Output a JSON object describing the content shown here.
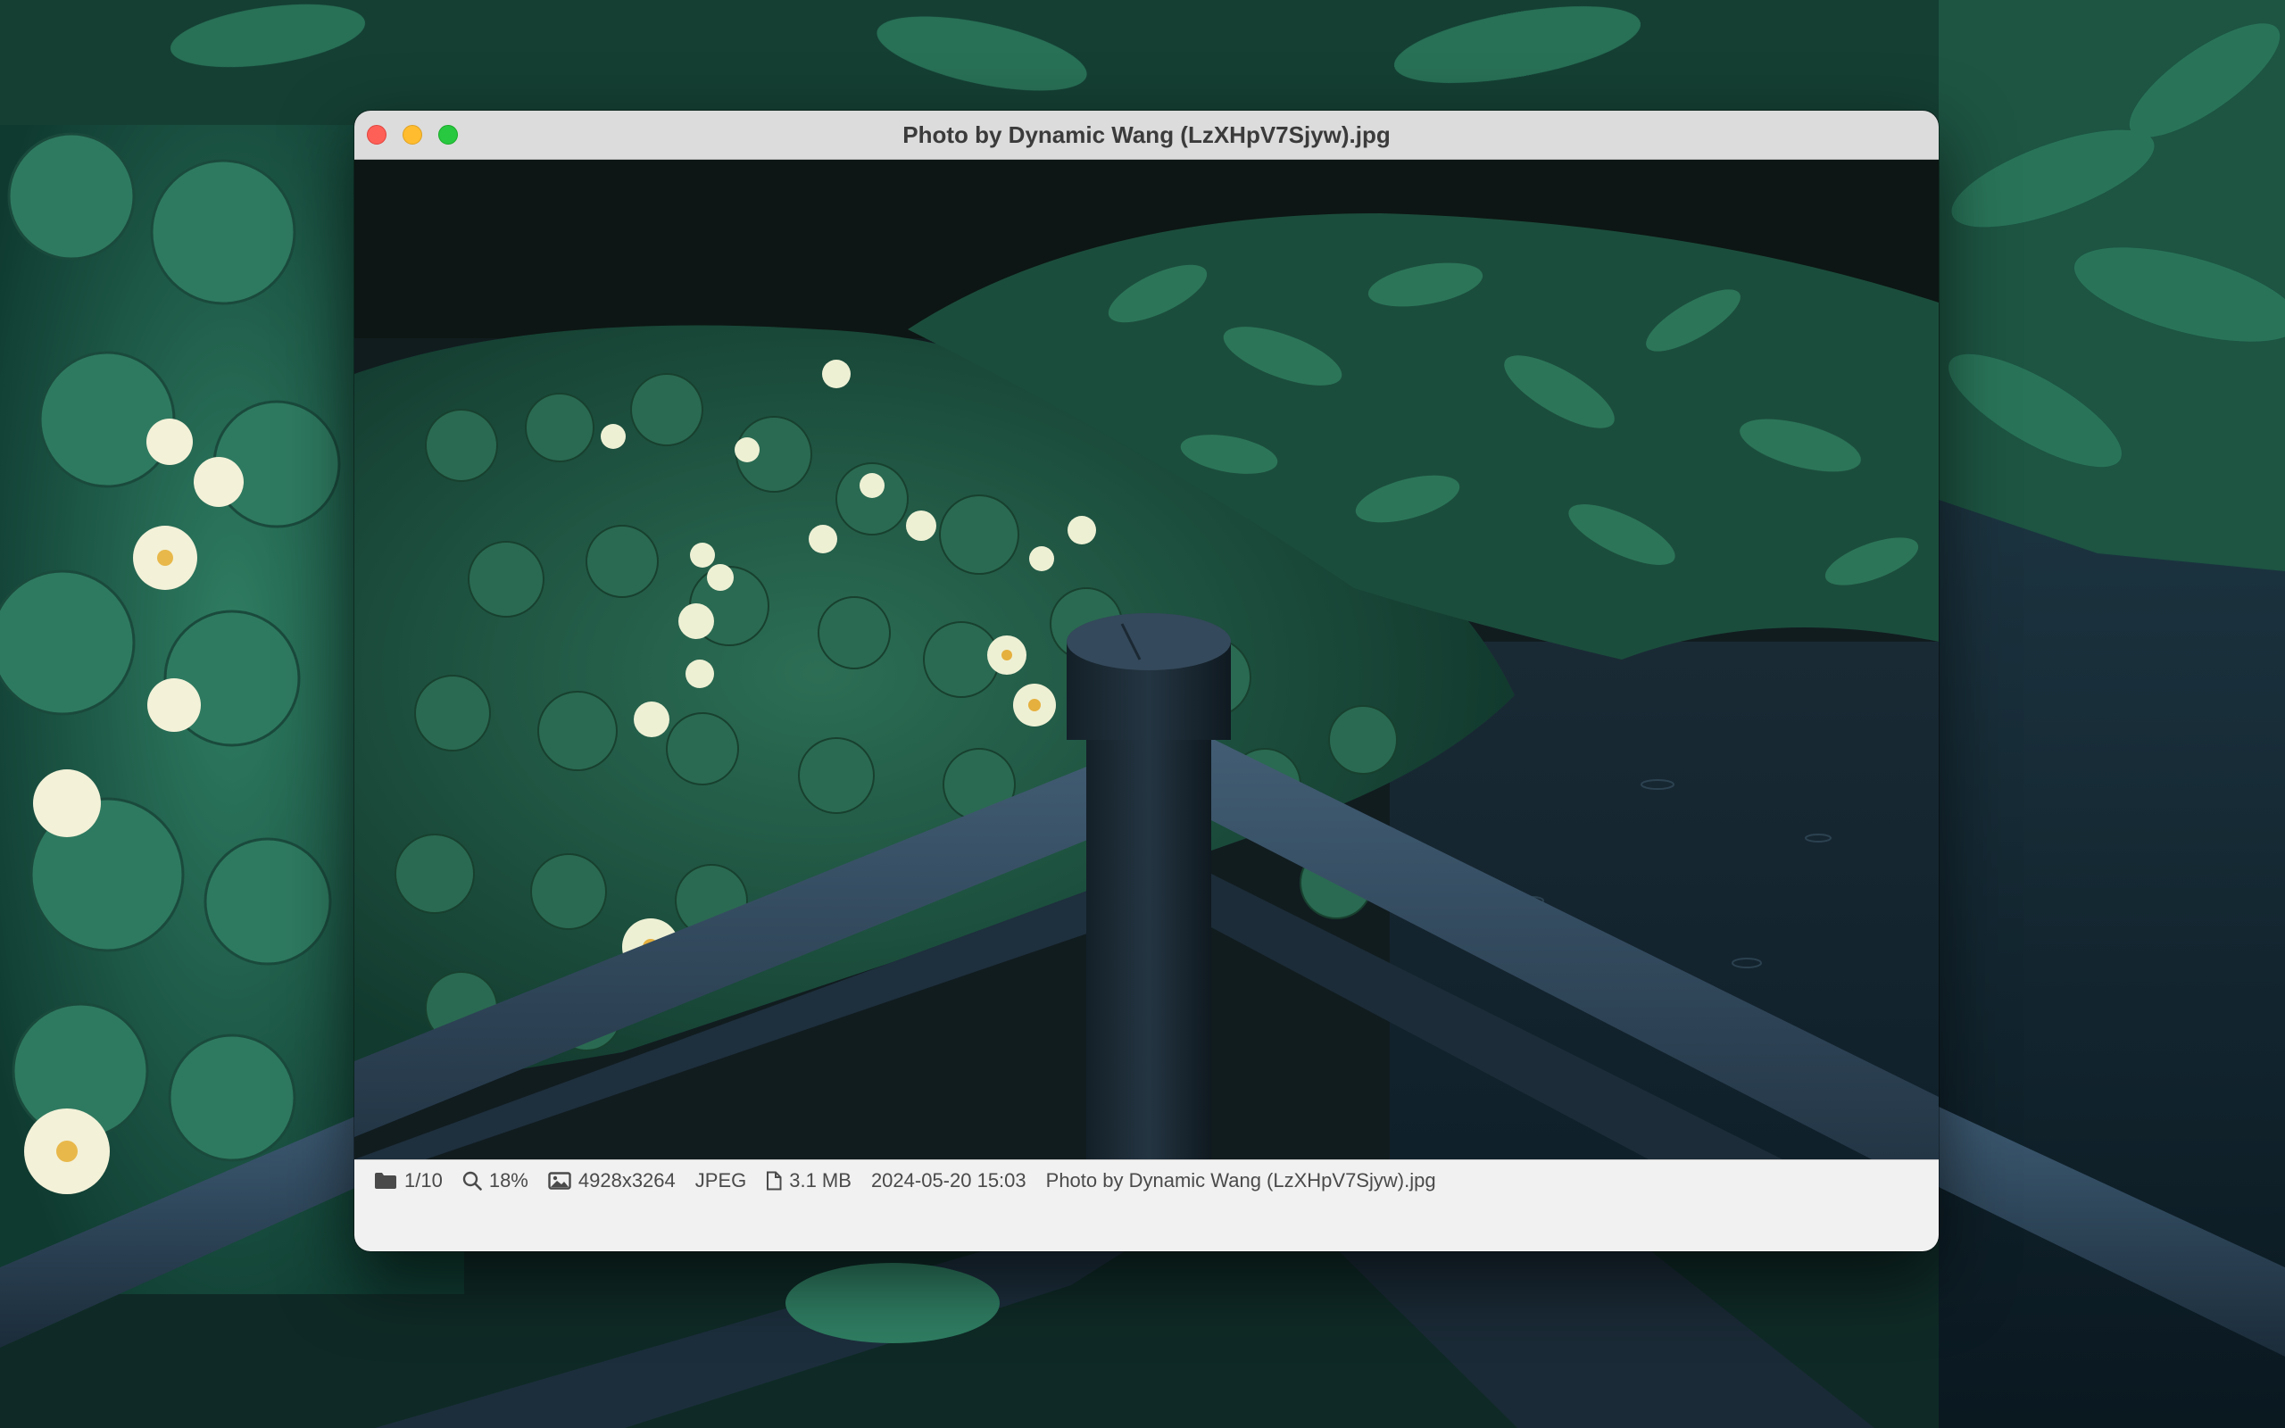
{
  "window": {
    "title": "Photo by Dynamic Wang (LzXHpV7Sjyw).jpg"
  },
  "statusbar": {
    "position": "1/10",
    "zoom": "18%",
    "dimensions": "4928x3264",
    "format": "JPEG",
    "file_size": "3.1 MB",
    "date": "2024-05-20 15:03",
    "filename": "Photo by Dynamic Wang (LzXHpV7Sjyw).jpg"
  },
  "icons": {
    "folder": "folder-icon",
    "zoom": "magnifier-icon",
    "dimensions": "image-icon",
    "file_size": "document-icon"
  },
  "colors": {
    "close": "#fe5f57",
    "minimize": "#febc2e",
    "maximize": "#28c840",
    "titlebar": "#dcdcdc",
    "statusbar": "#f1f1f1"
  }
}
